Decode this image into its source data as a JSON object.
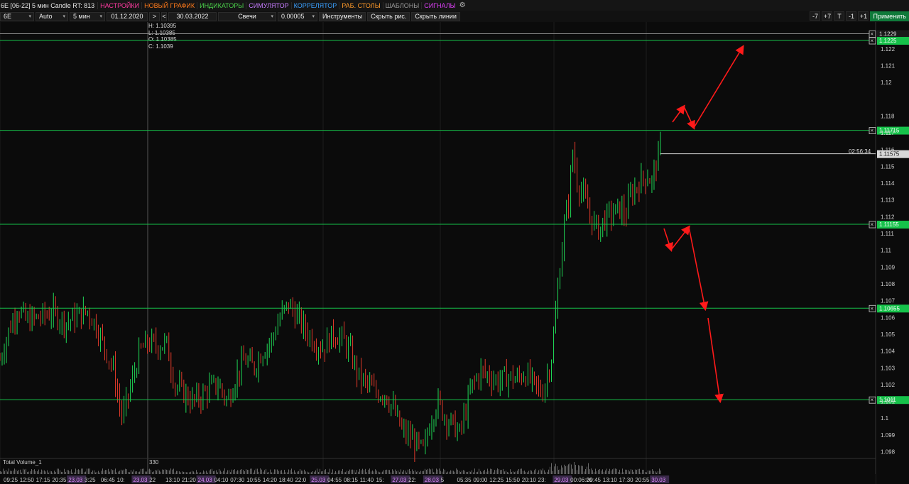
{
  "menubar": {
    "title": "6E [06-22] 5 мин Candle RT: 813",
    "items": [
      {
        "label": "НАСТРОЙКИ",
        "color": "#ff3aa0"
      },
      {
        "label": "НОВЫЙ ГРАФИК",
        "color": "#ff7a1a"
      },
      {
        "label": "ИНДИКАТОРЫ",
        "color": "#4bd14b"
      },
      {
        "label": "СИМУЛЯТОР",
        "color": "#c77dff"
      },
      {
        "label": "КОРРЕЛЯТОР",
        "color": "#3aa0ff"
      },
      {
        "label": "РАБ. СТОЛЫ",
        "color": "#ff9a2a"
      },
      {
        "label": "ШАБЛОНЫ",
        "color": "#9a9a9a"
      },
      {
        "label": "СИГНАЛЫ",
        "color": "#e040fb"
      }
    ]
  },
  "toolbar": {
    "symbol": "6E",
    "scale": "Auto",
    "timeframe": "5 мин",
    "date_from": "01.12.2020",
    "next_label": ">",
    "prev_label": "<",
    "date_to": "30.03.2022",
    "chart_type": "Свечи",
    "tick_size": "0.00005",
    "tools_label": "Инструменты",
    "hide_drawings_label": "Скрыть рис.",
    "hide_lines_label": "Скрыть линии",
    "btn_minus7": "-7",
    "btn_plus7": "+7",
    "btn_t": "T",
    "btn_minus1": "-1",
    "btn_plus1": "+1",
    "apply_label": "Применить"
  },
  "ohlc": {
    "h": "H: 1.10395",
    "l": "L: 1.10385",
    "o": "O: 1.10385",
    "c": "C: 1.1039"
  },
  "chart_data": {
    "type": "candlestick",
    "price_axis_ticks": [
      "1.122",
      "1.121",
      "1.12",
      "1.118",
      "1.117",
      "1.116",
      "1.115",
      "1.114",
      "1.113",
      "1.112",
      "1.111",
      "1.11",
      "1.109",
      "1.108",
      "1.107",
      "1.106",
      "1.105",
      "1.104",
      "1.103",
      "1.102",
      "1.101",
      "1.1",
      "1.099",
      "1.098"
    ],
    "ylim": [
      1.0976,
      1.1236
    ],
    "horizontal_levels": [
      {
        "price": 1.1229,
        "label": "1.1229",
        "color": "#8a8a8a"
      },
      {
        "price": 1.1225,
        "label": "1.1225",
        "color": "#16c24a"
      },
      {
        "price": 1.11715,
        "label": "1.11715",
        "color": "#16c24a"
      },
      {
        "price": 1.11155,
        "label": "1.11155",
        "color": "#16c24a"
      },
      {
        "price": 1.10655,
        "label": "1.10655",
        "color": "#16c24a"
      },
      {
        "price": 1.1011,
        "label": "1.1011",
        "color": "#16c24a"
      }
    ],
    "last_price": {
      "price": 1.11575,
      "label": "1.11575",
      "timer": "02:56:34"
    },
    "time_axis_labels": [
      "09:25",
      "12:50",
      "17:15",
      "20:35",
      "23.03",
      "3:25",
      "06:45",
      "10:",
      "23.03",
      "22",
      "13:10",
      "21:20",
      "24.03",
      "04:10",
      "07:30",
      "10:55",
      "14:20",
      "18:40",
      "22:0",
      "25.03",
      "04:55",
      "08:15",
      "11:40",
      "15:",
      "27.03",
      "22:",
      "28.03",
      "5",
      "05:35",
      "09:00",
      "12:25",
      "15:50",
      "20:10",
      "23:",
      "29.03",
      "00:06:20",
      "09:45",
      "13:10",
      "17:30",
      "20:55",
      "30.03"
    ],
    "price_path": [
      [
        0,
        1.1035
      ],
      [
        0.01,
        1.1052
      ],
      [
        0.02,
        1.1066
      ],
      [
        0.03,
        1.1058
      ],
      [
        0.045,
        1.106
      ],
      [
        0.06,
        1.1063
      ],
      [
        0.075,
        1.1057
      ],
      [
        0.09,
        1.1061
      ],
      [
        0.1,
        1.1064
      ],
      [
        0.11,
        1.1055
      ],
      [
        0.12,
        1.1042
      ],
      [
        0.13,
        1.1028
      ],
      [
        0.135,
        1.1012
      ],
      [
        0.14,
        1.1
      ],
      [
        0.15,
        1.102
      ],
      [
        0.16,
        1.104
      ],
      [
        0.17,
        1.1045
      ],
      [
        0.18,
        1.1043
      ],
      [
        0.19,
        1.1045
      ],
      [
        0.2,
        1.102
      ],
      [
        0.21,
        1.1015
      ],
      [
        0.22,
        1.101
      ],
      [
        0.23,
        1.1013
      ],
      [
        0.24,
        1.1018
      ],
      [
        0.25,
        1.102
      ],
      [
        0.26,
        1.101
      ],
      [
        0.27,
        1.1025
      ],
      [
        0.28,
        1.1035
      ],
      [
        0.29,
        1.103
      ],
      [
        0.3,
        1.104
      ],
      [
        0.31,
        1.1046
      ],
      [
        0.32,
        1.106
      ],
      [
        0.33,
        1.1068
      ],
      [
        0.34,
        1.106
      ],
      [
        0.35,
        1.1052
      ],
      [
        0.36,
        1.1045
      ],
      [
        0.37,
        1.1042
      ],
      [
        0.38,
        1.105
      ],
      [
        0.39,
        1.1048
      ],
      [
        0.4,
        1.104
      ],
      [
        0.41,
        1.1025
      ],
      [
        0.42,
        1.102
      ],
      [
        0.43,
        1.1015
      ],
      [
        0.44,
        1.1015
      ],
      [
        0.45,
        1.1005
      ],
      [
        0.46,
        1.0992
      ],
      [
        0.47,
        1.0988
      ],
      [
        0.48,
        1.0982
      ],
      [
        0.485,
        1.098
      ],
      [
        0.49,
        1.0995
      ],
      [
        0.5,
        1.101
      ],
      [
        0.51,
        1.1
      ],
      [
        0.52,
        1.0995
      ],
      [
        0.525,
        1.099
      ],
      [
        0.53,
        1.1
      ],
      [
        0.54,
        1.102
      ],
      [
        0.55,
        1.1028
      ],
      [
        0.56,
        1.1025
      ],
      [
        0.57,
        1.1022
      ],
      [
        0.58,
        1.1025
      ],
      [
        0.59,
        1.1023
      ],
      [
        0.6,
        1.1027
      ],
      [
        0.61,
        1.102
      ],
      [
        0.62,
        1.1015
      ],
      [
        0.63,
        1.1035
      ],
      [
        0.635,
        1.106
      ],
      [
        0.64,
        1.109
      ],
      [
        0.645,
        1.1115
      ],
      [
        0.65,
        1.113
      ],
      [
        0.655,
        1.116
      ],
      [
        0.66,
        1.114
      ],
      [
        0.665,
        1.1135
      ],
      [
        0.67,
        1.1128
      ],
      [
        0.675,
        1.112
      ],
      [
        0.68,
        1.1115
      ],
      [
        0.685,
        1.1112
      ],
      [
        0.69,
        1.1118
      ],
      [
        0.7,
        1.1122
      ],
      [
        0.71,
        1.1125
      ],
      [
        0.715,
        1.112
      ],
      [
        0.72,
        1.1132
      ],
      [
        0.73,
        1.114
      ],
      [
        0.74,
        1.1145
      ],
      [
        0.745,
        1.114
      ],
      [
        0.75,
        1.1152
      ],
      [
        0.755,
        1.116
      ]
    ],
    "arrows": [
      [
        [
          935,
          322
        ],
        [
          945,
          352
        ]
      ],
      [
        [
          945,
          352
        ],
        [
          970,
          320
        ]
      ],
      [
        [
          970,
          320
        ],
        [
          993,
          435
        ]
      ],
      [
        [
          997,
          448
        ],
        [
          1014,
          565
        ]
      ],
      [
        [
          947,
          172
        ],
        [
          963,
          150
        ]
      ],
      [
        [
          963,
          150
        ],
        [
          977,
          180
        ]
      ],
      [
        [
          977,
          180
        ],
        [
          1046,
          66
        ]
      ]
    ],
    "volume_label": "Total Volume_1",
    "volume_value": "330"
  }
}
